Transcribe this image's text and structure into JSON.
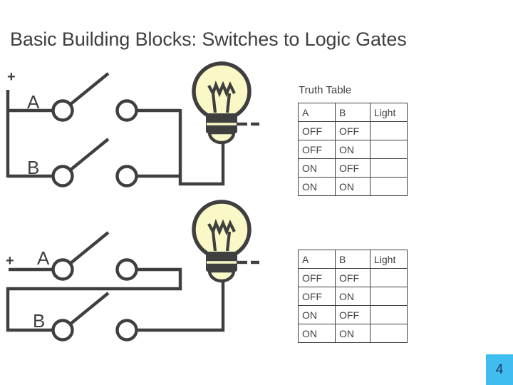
{
  "slide": {
    "title": "Basic Building Blocks: Switches to Logic Gates",
    "page_number": "4",
    "accent_color": "#3fbcf0",
    "ink_color": "#3f3f3f",
    "bulb_fill_color": "#fbf8c8",
    "background_color": "#ffffff"
  },
  "circuits": [
    {
      "id": "parallel-circuit",
      "positive_terminal_label": "+",
      "negative_terminal_label": "-",
      "switch_a_label": "A",
      "switch_b_label": "B",
      "lamp_icon": "light-bulb-icon"
    },
    {
      "id": "series-circuit",
      "positive_terminal_label": "+",
      "negative_terminal_label": "-",
      "switch_a_label": "A",
      "switch_b_label": "B",
      "lamp_icon": "light-bulb-icon"
    }
  ],
  "truth_tables": [
    {
      "id": "truth-table-parallel",
      "caption": "Truth Table",
      "headers": [
        "A",
        "B",
        "Light"
      ],
      "rows": [
        [
          "OFF",
          "OFF",
          ""
        ],
        [
          "OFF",
          "ON",
          ""
        ],
        [
          "ON",
          "OFF",
          ""
        ],
        [
          "ON",
          "ON",
          ""
        ]
      ]
    },
    {
      "id": "truth-table-series",
      "caption": "",
      "headers": [
        "A",
        "B",
        "Light"
      ],
      "rows": [
        [
          "OFF",
          "OFF",
          ""
        ],
        [
          "OFF",
          "ON",
          ""
        ],
        [
          "ON",
          "OFF",
          ""
        ],
        [
          "ON",
          "ON",
          ""
        ]
      ]
    }
  ]
}
